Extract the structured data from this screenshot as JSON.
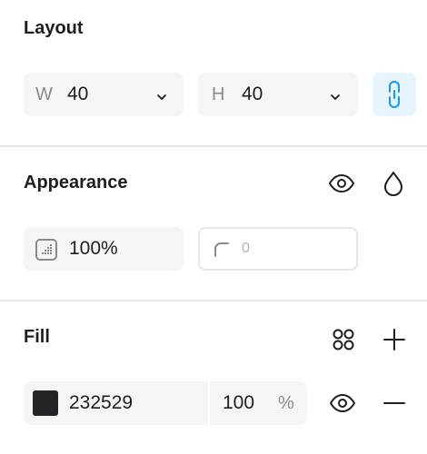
{
  "layout": {
    "title": "Layout",
    "width": {
      "prefix": "W",
      "value": "40"
    },
    "height": {
      "prefix": "H",
      "value": "40"
    },
    "icons": {
      "dropdown": "chevron-down-icon",
      "constrain": "link-icon"
    },
    "accent": "#0d99ff",
    "accent_bg": "#e5f4ff"
  },
  "appearance": {
    "title": "Appearance",
    "opacity": "100%",
    "corner_radius": "0",
    "icons": {
      "visibility": "eye-icon",
      "blend": "droplet-icon",
      "opacity": "opacity-icon",
      "radius": "corner-radius-icon"
    }
  },
  "fill": {
    "title": "Fill",
    "hex": "232529",
    "opacity": "100",
    "percent": "%",
    "swatch_color": "#232529",
    "icons": {
      "styles": "styles-grid-icon",
      "add": "plus-icon",
      "visibility": "eye-icon",
      "remove": "minus-icon"
    }
  }
}
